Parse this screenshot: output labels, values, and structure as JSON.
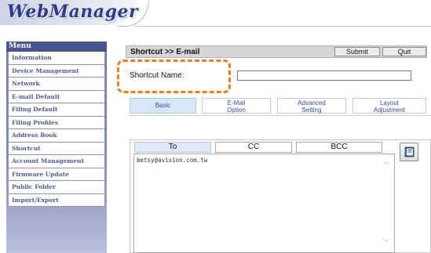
{
  "app": {
    "logo": "WebManager"
  },
  "sidebar": {
    "title": "Menu",
    "items": [
      "Information",
      "Device Management",
      "Network",
      "E-mail Default",
      "Filing Default",
      "Filing Profiles",
      "Address Book",
      "Shortcut",
      "Account Management",
      "Firmware Update",
      "Public Folder",
      "Import/Export"
    ]
  },
  "titlebar": {
    "breadcrumb": "Shortcut >> E-mail",
    "submit_label": "Submit",
    "quit_label": "Quit"
  },
  "form": {
    "shortcut_name_label": "Shortcut Name:",
    "shortcut_name_value": ""
  },
  "tabs": [
    {
      "line1": "Basic",
      "line2": ""
    },
    {
      "line1": "E-Mail",
      "line2": "Option"
    },
    {
      "line1": "Advanced",
      "line2": "Setting"
    },
    {
      "line1": "Layout",
      "line2": "Adjustment"
    }
  ],
  "recipients": {
    "tabs": [
      "To",
      "CC",
      "BCC"
    ],
    "to_value": "betsy@avision.com.tw"
  },
  "colors": {
    "highlight": "#f07d22",
    "menu_header": "#4a5590",
    "tab_text": "#2f4fa0"
  },
  "icons": {
    "address_book": "address-book-icon"
  }
}
